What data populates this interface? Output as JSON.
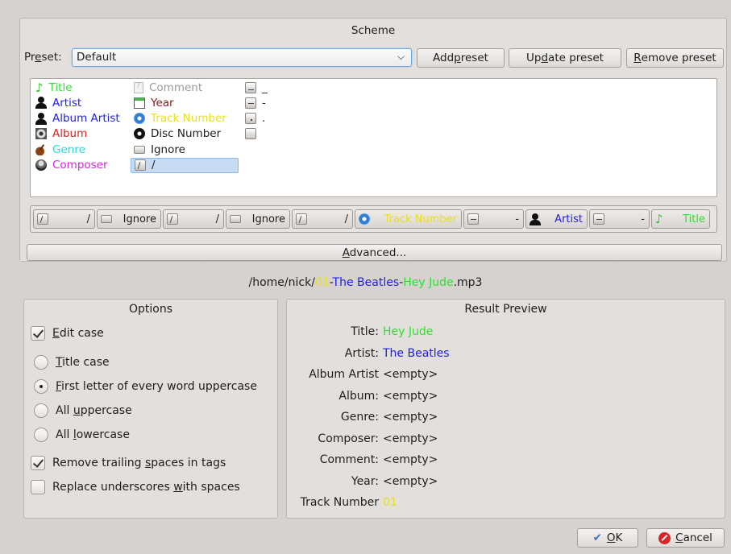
{
  "scheme": {
    "title": "Scheme",
    "preset_label_pre": "Preset:",
    "preset_value": "Default",
    "add_preset": "Add preset",
    "update_preset": "Update preset",
    "remove_preset": "Remove preset"
  },
  "palette": {
    "col1": [
      {
        "label": "Title",
        "icon": "music-note-icon",
        "color": "#33dd33"
      },
      {
        "label": "Artist",
        "icon": "person-icon",
        "color": "#2222dd"
      },
      {
        "label": "Album Artist",
        "icon": "person-icon",
        "color": "#2222dd"
      },
      {
        "label": "Album",
        "icon": "album-icon",
        "color": "#dd2222"
      },
      {
        "label": "Genre",
        "icon": "guitar-icon",
        "color": "#22dddd"
      },
      {
        "label": "Composer",
        "icon": "composer-icon",
        "color": "#dd22dd"
      }
    ],
    "col2": [
      {
        "label": "Comment",
        "icon": "comment-icon",
        "color": "#999999"
      },
      {
        "label": "Year",
        "icon": "calendar-icon",
        "color": "#8b1a1a"
      },
      {
        "label": "Track Number",
        "icon": "disc-icon",
        "color": "#e8e020"
      },
      {
        "label": "Disc Number",
        "icon": "disc-black-icon",
        "color": "#1e1e1e"
      },
      {
        "label": "Ignore",
        "icon": "ignore-icon",
        "color": "#1e1e1e"
      },
      {
        "label": "/",
        "icon": "slash-key-icon",
        "color": "#1e1e1e"
      }
    ],
    "col3": [
      {
        "label": "_",
        "icon": "underscore-key-icon"
      },
      {
        "label": "-",
        "icon": "dash-key-icon"
      },
      {
        "label": ".",
        "icon": "dot-key-icon"
      },
      {
        "label": "",
        "icon": "space-key-icon"
      }
    ]
  },
  "tokens": [
    {
      "label": "/",
      "icon": "slash-key-icon",
      "color": "#1e1e1e"
    },
    {
      "label": "Ignore",
      "icon": "ignore-icon",
      "color": "#1e1e1e"
    },
    {
      "label": "/",
      "icon": "slash-key-icon",
      "color": "#1e1e1e"
    },
    {
      "label": "Ignore",
      "icon": "ignore-icon",
      "color": "#1e1e1e"
    },
    {
      "label": "/",
      "icon": "slash-key-icon",
      "color": "#1e1e1e"
    },
    {
      "label": "Track Number",
      "icon": "disc-icon",
      "color": "#e8e020"
    },
    {
      "label": "-",
      "icon": "dash-key-icon",
      "color": "#1e1e1e"
    },
    {
      "label": "Artist",
      "icon": "person-icon",
      "color": "#2222dd"
    },
    {
      "label": "-",
      "icon": "dash-key-icon",
      "color": "#1e1e1e"
    },
    {
      "label": "Title",
      "icon": "music-note-icon",
      "color": "#33dd33"
    }
  ],
  "advanced_label": "Advanced...",
  "filepath": {
    "prefix": "/home/nick/",
    "track": "01",
    "sep1": "-",
    "artist": "The Beatles",
    "sep2": "-",
    "title": "Hey Jude",
    "ext": ".mp3"
  },
  "options": {
    "title": "Options",
    "edit_case": "Edit case",
    "title_case": "Title case",
    "first_letter": "First letter of every word uppercase",
    "all_upper": "All uppercase",
    "all_lower": "All lowercase",
    "remove_trailing": "Remove trailing spaces in tags",
    "replace_underscores": "Replace underscores with spaces"
  },
  "preview": {
    "title": "Result Preview",
    "rows": [
      {
        "label": "Title:",
        "value": "Hey Jude",
        "color": "#33dd33"
      },
      {
        "label": "Artist:",
        "value": "The Beatles",
        "color": "#2222dd"
      },
      {
        "label": "Album Artist",
        "value": "<empty>",
        "color": "#1e1e1e"
      },
      {
        "label": "Album:",
        "value": "<empty>",
        "color": "#1e1e1e"
      },
      {
        "label": "Genre:",
        "value": "<empty>",
        "color": "#1e1e1e"
      },
      {
        "label": "Composer:",
        "value": "<empty>",
        "color": "#1e1e1e"
      },
      {
        "label": "Comment:",
        "value": "<empty>",
        "color": "#1e1e1e"
      },
      {
        "label": "Year:",
        "value": "<empty>",
        "color": "#1e1e1e"
      },
      {
        "label": "Track Number",
        "value": "01",
        "color": "#e8e020"
      }
    ]
  },
  "dialog": {
    "ok": "OK",
    "cancel": "Cancel"
  }
}
